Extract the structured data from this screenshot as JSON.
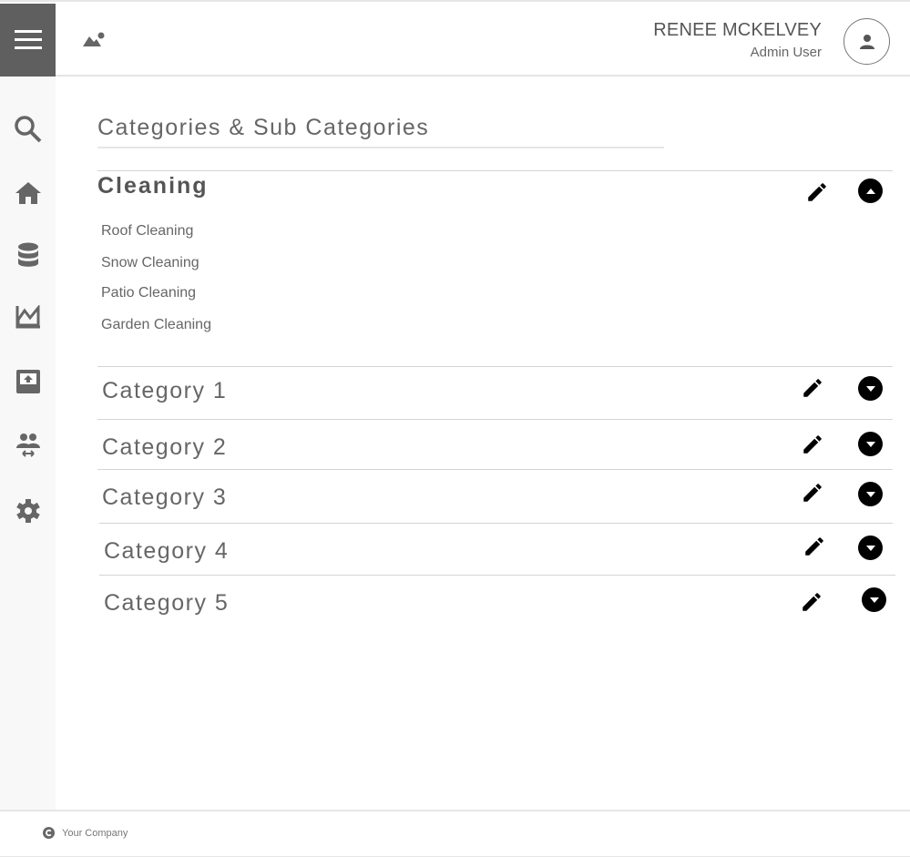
{
  "header": {
    "user_name": "RENEE MCKELVEY",
    "user_role": "Admin User"
  },
  "sidebar": {
    "items": [
      {
        "icon": "search-icon"
      },
      {
        "icon": "home-icon"
      },
      {
        "icon": "database-icon"
      },
      {
        "icon": "chart-icon"
      },
      {
        "icon": "upload-icon"
      },
      {
        "icon": "people-transfer-icon"
      },
      {
        "icon": "gear-icon"
      }
    ]
  },
  "main": {
    "title": "Categories & Sub Categories",
    "open_category": {
      "label": "Cleaning",
      "subcategories": [
        "Roof Cleaning",
        "Snow Cleaning",
        "Patio Cleaning",
        "Garden Cleaning"
      ]
    },
    "categories": [
      {
        "label": "Category 1"
      },
      {
        "label": "Category 2"
      },
      {
        "label": "Category 3"
      },
      {
        "label": "Category 4"
      },
      {
        "label": "Category 5"
      }
    ]
  },
  "footer": {
    "company": "Your Company"
  }
}
